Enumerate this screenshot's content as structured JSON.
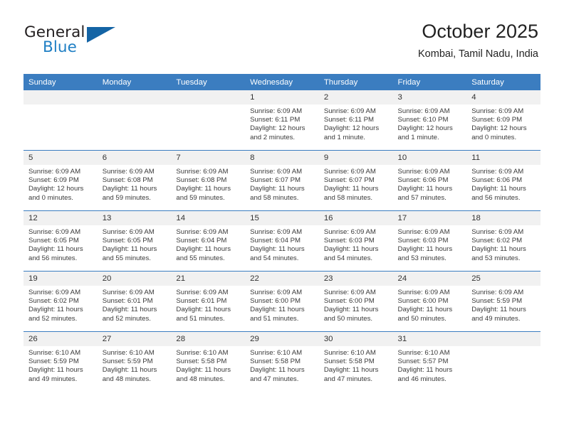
{
  "brand": {
    "name_part1": "General",
    "name_part2": "Blue",
    "logo_icon": "triangle-logo-icon",
    "accent_color": "#1464a5",
    "blue_text_color": "#1f7fc4"
  },
  "header": {
    "title": "October 2025",
    "subtitle": "Kombai, Tamil Nadu, India"
  },
  "calendar": {
    "header_bg": "#3b7dc0",
    "daynum_bg": "#f1f1f1",
    "weekdays": [
      "Sunday",
      "Monday",
      "Tuesday",
      "Wednesday",
      "Thursday",
      "Friday",
      "Saturday"
    ],
    "weeks": [
      [
        {
          "day": "",
          "empty": true
        },
        {
          "day": "",
          "empty": true
        },
        {
          "day": "",
          "empty": true
        },
        {
          "day": "1",
          "sunrise": "Sunrise: 6:09 AM",
          "sunset": "Sunset: 6:11 PM",
          "daylight_1": "Daylight: 12 hours",
          "daylight_2": "and 2 minutes."
        },
        {
          "day": "2",
          "sunrise": "Sunrise: 6:09 AM",
          "sunset": "Sunset: 6:11 PM",
          "daylight_1": "Daylight: 12 hours",
          "daylight_2": "and 1 minute."
        },
        {
          "day": "3",
          "sunrise": "Sunrise: 6:09 AM",
          "sunset": "Sunset: 6:10 PM",
          "daylight_1": "Daylight: 12 hours",
          "daylight_2": "and 1 minute."
        },
        {
          "day": "4",
          "sunrise": "Sunrise: 6:09 AM",
          "sunset": "Sunset: 6:09 PM",
          "daylight_1": "Daylight: 12 hours",
          "daylight_2": "and 0 minutes."
        }
      ],
      [
        {
          "day": "5",
          "sunrise": "Sunrise: 6:09 AM",
          "sunset": "Sunset: 6:09 PM",
          "daylight_1": "Daylight: 12 hours",
          "daylight_2": "and 0 minutes."
        },
        {
          "day": "6",
          "sunrise": "Sunrise: 6:09 AM",
          "sunset": "Sunset: 6:08 PM",
          "daylight_1": "Daylight: 11 hours",
          "daylight_2": "and 59 minutes."
        },
        {
          "day": "7",
          "sunrise": "Sunrise: 6:09 AM",
          "sunset": "Sunset: 6:08 PM",
          "daylight_1": "Daylight: 11 hours",
          "daylight_2": "and 59 minutes."
        },
        {
          "day": "8",
          "sunrise": "Sunrise: 6:09 AM",
          "sunset": "Sunset: 6:07 PM",
          "daylight_1": "Daylight: 11 hours",
          "daylight_2": "and 58 minutes."
        },
        {
          "day": "9",
          "sunrise": "Sunrise: 6:09 AM",
          "sunset": "Sunset: 6:07 PM",
          "daylight_1": "Daylight: 11 hours",
          "daylight_2": "and 58 minutes."
        },
        {
          "day": "10",
          "sunrise": "Sunrise: 6:09 AM",
          "sunset": "Sunset: 6:06 PM",
          "daylight_1": "Daylight: 11 hours",
          "daylight_2": "and 57 minutes."
        },
        {
          "day": "11",
          "sunrise": "Sunrise: 6:09 AM",
          "sunset": "Sunset: 6:06 PM",
          "daylight_1": "Daylight: 11 hours",
          "daylight_2": "and 56 minutes."
        }
      ],
      [
        {
          "day": "12",
          "sunrise": "Sunrise: 6:09 AM",
          "sunset": "Sunset: 6:05 PM",
          "daylight_1": "Daylight: 11 hours",
          "daylight_2": "and 56 minutes."
        },
        {
          "day": "13",
          "sunrise": "Sunrise: 6:09 AM",
          "sunset": "Sunset: 6:05 PM",
          "daylight_1": "Daylight: 11 hours",
          "daylight_2": "and 55 minutes."
        },
        {
          "day": "14",
          "sunrise": "Sunrise: 6:09 AM",
          "sunset": "Sunset: 6:04 PM",
          "daylight_1": "Daylight: 11 hours",
          "daylight_2": "and 55 minutes."
        },
        {
          "day": "15",
          "sunrise": "Sunrise: 6:09 AM",
          "sunset": "Sunset: 6:04 PM",
          "daylight_1": "Daylight: 11 hours",
          "daylight_2": "and 54 minutes."
        },
        {
          "day": "16",
          "sunrise": "Sunrise: 6:09 AM",
          "sunset": "Sunset: 6:03 PM",
          "daylight_1": "Daylight: 11 hours",
          "daylight_2": "and 54 minutes."
        },
        {
          "day": "17",
          "sunrise": "Sunrise: 6:09 AM",
          "sunset": "Sunset: 6:03 PM",
          "daylight_1": "Daylight: 11 hours",
          "daylight_2": "and 53 minutes."
        },
        {
          "day": "18",
          "sunrise": "Sunrise: 6:09 AM",
          "sunset": "Sunset: 6:02 PM",
          "daylight_1": "Daylight: 11 hours",
          "daylight_2": "and 53 minutes."
        }
      ],
      [
        {
          "day": "19",
          "sunrise": "Sunrise: 6:09 AM",
          "sunset": "Sunset: 6:02 PM",
          "daylight_1": "Daylight: 11 hours",
          "daylight_2": "and 52 minutes."
        },
        {
          "day": "20",
          "sunrise": "Sunrise: 6:09 AM",
          "sunset": "Sunset: 6:01 PM",
          "daylight_1": "Daylight: 11 hours",
          "daylight_2": "and 52 minutes."
        },
        {
          "day": "21",
          "sunrise": "Sunrise: 6:09 AM",
          "sunset": "Sunset: 6:01 PM",
          "daylight_1": "Daylight: 11 hours",
          "daylight_2": "and 51 minutes."
        },
        {
          "day": "22",
          "sunrise": "Sunrise: 6:09 AM",
          "sunset": "Sunset: 6:00 PM",
          "daylight_1": "Daylight: 11 hours",
          "daylight_2": "and 51 minutes."
        },
        {
          "day": "23",
          "sunrise": "Sunrise: 6:09 AM",
          "sunset": "Sunset: 6:00 PM",
          "daylight_1": "Daylight: 11 hours",
          "daylight_2": "and 50 minutes."
        },
        {
          "day": "24",
          "sunrise": "Sunrise: 6:09 AM",
          "sunset": "Sunset: 6:00 PM",
          "daylight_1": "Daylight: 11 hours",
          "daylight_2": "and 50 minutes."
        },
        {
          "day": "25",
          "sunrise": "Sunrise: 6:09 AM",
          "sunset": "Sunset: 5:59 PM",
          "daylight_1": "Daylight: 11 hours",
          "daylight_2": "and 49 minutes."
        }
      ],
      [
        {
          "day": "26",
          "sunrise": "Sunrise: 6:10 AM",
          "sunset": "Sunset: 5:59 PM",
          "daylight_1": "Daylight: 11 hours",
          "daylight_2": "and 49 minutes."
        },
        {
          "day": "27",
          "sunrise": "Sunrise: 6:10 AM",
          "sunset": "Sunset: 5:59 PM",
          "daylight_1": "Daylight: 11 hours",
          "daylight_2": "and 48 minutes."
        },
        {
          "day": "28",
          "sunrise": "Sunrise: 6:10 AM",
          "sunset": "Sunset: 5:58 PM",
          "daylight_1": "Daylight: 11 hours",
          "daylight_2": "and 48 minutes."
        },
        {
          "day": "29",
          "sunrise": "Sunrise: 6:10 AM",
          "sunset": "Sunset: 5:58 PM",
          "daylight_1": "Daylight: 11 hours",
          "daylight_2": "and 47 minutes."
        },
        {
          "day": "30",
          "sunrise": "Sunrise: 6:10 AM",
          "sunset": "Sunset: 5:58 PM",
          "daylight_1": "Daylight: 11 hours",
          "daylight_2": "and 47 minutes."
        },
        {
          "day": "31",
          "sunrise": "Sunrise: 6:10 AM",
          "sunset": "Sunset: 5:57 PM",
          "daylight_1": "Daylight: 11 hours",
          "daylight_2": "and 46 minutes."
        },
        {
          "day": "",
          "empty": true
        }
      ]
    ]
  }
}
